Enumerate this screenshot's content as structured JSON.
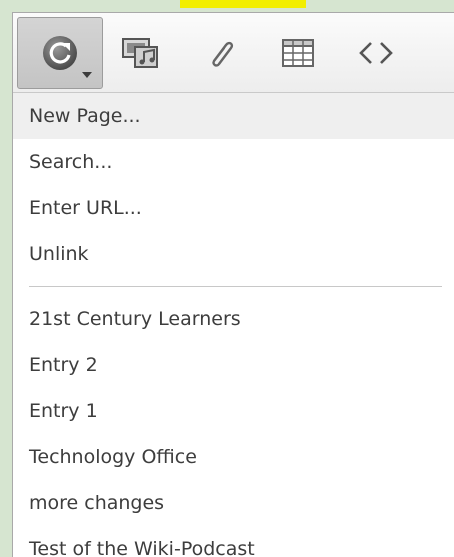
{
  "toolbar": {
    "tools": [
      {
        "name": "link-tool",
        "icon": "refresh-icon"
      },
      {
        "name": "media-tool",
        "icon": "media-icon"
      },
      {
        "name": "attachment-tool",
        "icon": "paperclip-icon"
      },
      {
        "name": "table-tool",
        "icon": "table-icon"
      },
      {
        "name": "html-tool",
        "icon": "code-icon"
      }
    ]
  },
  "menu": {
    "actions": [
      {
        "label": "New Page..."
      },
      {
        "label": "Search..."
      },
      {
        "label": "Enter URL..."
      },
      {
        "label": "Unlink"
      }
    ],
    "pages": [
      {
        "label": "21st Century Learners"
      },
      {
        "label": "Entry 2"
      },
      {
        "label": "Entry 1"
      },
      {
        "label": "Technology Office"
      },
      {
        "label": "more changes"
      },
      {
        "label": "Test of the Wiki-Podcast"
      }
    ]
  },
  "colors": {
    "background": "#d6e5d0",
    "highlight": "#f2ee00",
    "hover_row": "#efefef",
    "text": "#3d3d3d"
  }
}
